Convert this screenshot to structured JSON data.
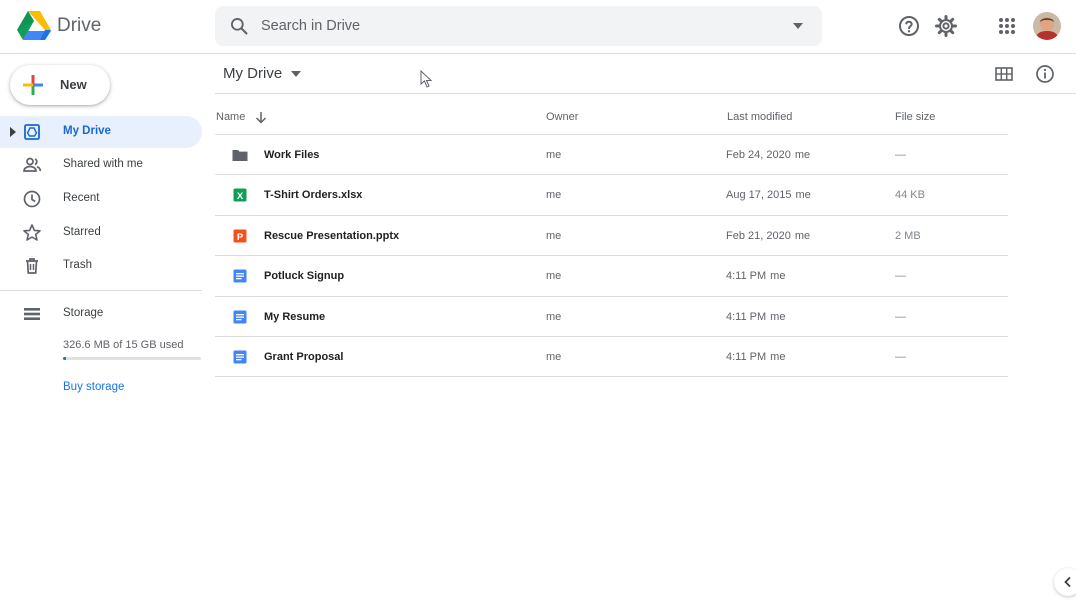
{
  "app": {
    "name": "Drive"
  },
  "search": {
    "placeholder": "Search in Drive"
  },
  "sidebar": {
    "new_label": "New",
    "items": [
      {
        "label": "My Drive",
        "icon": "my-drive-icon",
        "active": true
      },
      {
        "label": "Shared with me",
        "icon": "shared-icon"
      },
      {
        "label": "Recent",
        "icon": "clock-icon"
      },
      {
        "label": "Starred",
        "icon": "star-icon"
      },
      {
        "label": "Trash",
        "icon": "trash-icon"
      }
    ],
    "storage": {
      "label": "Storage",
      "usage_text": "326.6 MB of 15 GB used",
      "used_fraction": 0.022,
      "buy_label": "Buy storage"
    }
  },
  "main": {
    "title": "My Drive",
    "columns": {
      "name": "Name",
      "owner": "Owner",
      "modified": "Last modified",
      "size": "File size"
    },
    "files": [
      {
        "name": "Work Files",
        "type": "folder",
        "owner": "me",
        "modified": "Feb 24, 2020",
        "by": "me",
        "size": "—"
      },
      {
        "name": "T-Shirt Orders.xlsx",
        "type": "sheet",
        "owner": "me",
        "modified": "Aug 17, 2015",
        "by": "me",
        "size": "44 KB"
      },
      {
        "name": "Rescue Presentation.pptx",
        "type": "slides",
        "owner": "me",
        "modified": "Feb 21, 2020",
        "by": "me",
        "size": "2 MB"
      },
      {
        "name": "Potluck Signup",
        "type": "doc",
        "owner": "me",
        "modified": "4:11 PM",
        "by": "me",
        "size": "—"
      },
      {
        "name": "My Resume",
        "type": "doc",
        "owner": "me",
        "modified": "4:11 PM",
        "by": "me",
        "size": "—"
      },
      {
        "name": "Grant Proposal",
        "type": "doc",
        "owner": "me",
        "modified": "4:11 PM",
        "by": "me",
        "size": "—"
      }
    ]
  },
  "colors": {
    "accent": "#1a73e8",
    "active_bg": "#e8f0fe",
    "sheet": "#0f9d58",
    "slides": "#f4511e",
    "doc": "#4285f4",
    "folder": "#5f6368"
  }
}
